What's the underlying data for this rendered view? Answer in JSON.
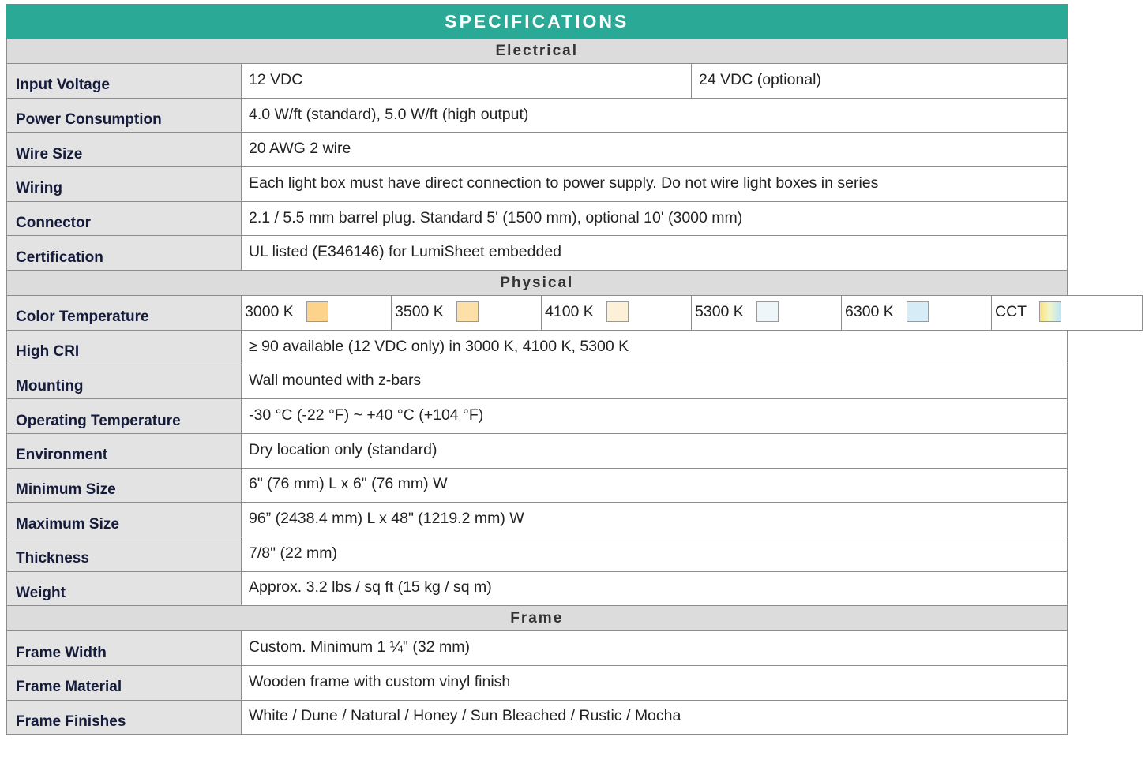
{
  "title": "SPECIFICATIONS",
  "sections": {
    "electrical": {
      "heading": "Electrical",
      "input_voltage": {
        "label": "Input Voltage",
        "value_1": "12 VDC",
        "value_2": "24 VDC (optional)"
      },
      "rows": [
        {
          "label": "Power Consumption",
          "value": "4.0 W/ft (standard), 5.0 W/ft (high output)"
        },
        {
          "label": "Wire Size",
          "value": "20 AWG 2 wire"
        },
        {
          "label": "Wiring",
          "value": "Each light box must have direct connection to power supply. Do not wire light boxes in series"
        },
        {
          "label": "Connector",
          "value": "2.1 / 5.5 mm barrel plug. Standard 5' (1500 mm), optional 10' (3000 mm)"
        },
        {
          "label": "Certification",
          "value": "UL listed (E346146) for LumiSheet embedded"
        }
      ]
    },
    "physical": {
      "heading": "Physical",
      "color_temperature": {
        "label": "Color Temperature",
        "options": [
          {
            "label": "3000 K",
            "color": "#fdd28a"
          },
          {
            "label": "3500 K",
            "color": "#fde0a8"
          },
          {
            "label": "4100 K",
            "color": "#fdf0d8"
          },
          {
            "label": "5300 K",
            "color": "#eef6fa"
          },
          {
            "label": "6300 K",
            "color": "#d6ecf6"
          },
          {
            "label": "CCT",
            "color": "gradient"
          }
        ]
      },
      "rows": [
        {
          "label": "High CRI",
          "value": "≥ 90 available (12 VDC only) in 3000 K, 4100 K, 5300 K"
        },
        {
          "label": "Mounting",
          "value": "Wall mounted with z-bars"
        },
        {
          "label": "Operating Temperature",
          "value": "-30 °C (-22 °F) ~ +40 °C (+104 °F)"
        },
        {
          "label": "Environment",
          "value": "Dry location only (standard)"
        },
        {
          "label": "Minimum Size",
          "value": "6\" (76 mm) L x 6\" (76 mm) W"
        },
        {
          "label": "Maximum Size",
          "value": "96” (2438.4 mm) L x 48\" (1219.2 mm) W"
        },
        {
          "label": "Thickness",
          "value": "7/8\" (22 mm)"
        },
        {
          "label": "Weight",
          "value": "Approx. 3.2 lbs / sq ft (15 kg / sq m)"
        }
      ]
    },
    "frame": {
      "heading": "Frame",
      "rows": [
        {
          "label": "Frame Width",
          "value": "Custom. Minimum 1 ¼\" (32 mm)"
        },
        {
          "label": "Frame Material",
          "value": "Wooden frame with custom vinyl finish"
        },
        {
          "label": "Frame Finishes",
          "value": "White / Dune / Natural / Honey / Sun Bleached / Rustic / Mocha"
        }
      ]
    }
  },
  "colors": {
    "header_bg": "#2aa996",
    "section_bg": "#dcdcdc",
    "label_bg": "#e3e3e3",
    "border": "#8c8c8c"
  }
}
